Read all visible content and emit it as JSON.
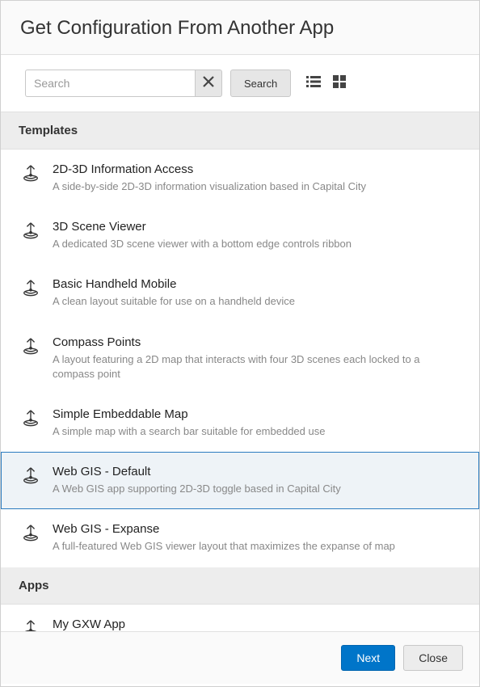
{
  "title": "Get Configuration From Another App",
  "search": {
    "placeholder": "Search",
    "button": "Search"
  },
  "sections": {
    "templates": "Templates",
    "apps": "Apps"
  },
  "templates": [
    {
      "title": "2D-3D Information Access",
      "desc": "A side-by-side 2D-3D information visualization based in Capital City"
    },
    {
      "title": "3D Scene Viewer",
      "desc": "A dedicated 3D scene viewer with a bottom edge controls ribbon"
    },
    {
      "title": "Basic Handheld Mobile",
      "desc": "A clean layout suitable for use on a handheld device"
    },
    {
      "title": "Compass Points",
      "desc": "A layout featuring a 2D map that interacts with four 3D scenes each locked to a compass point"
    },
    {
      "title": "Simple Embeddable Map",
      "desc": "A simple map with a search bar suitable for embedded use"
    },
    {
      "title": "Web GIS - Default",
      "desc": "A Web GIS app supporting 2D-3D toggle based in Capital City"
    },
    {
      "title": "Web GIS - Expanse",
      "desc": "A full-featured Web GIS viewer layout that maximizes the expanse of map"
    }
  ],
  "apps": [
    {
      "title": "My GXW App",
      "desc": ""
    }
  ],
  "footer": {
    "next": "Next",
    "close": "Close"
  }
}
